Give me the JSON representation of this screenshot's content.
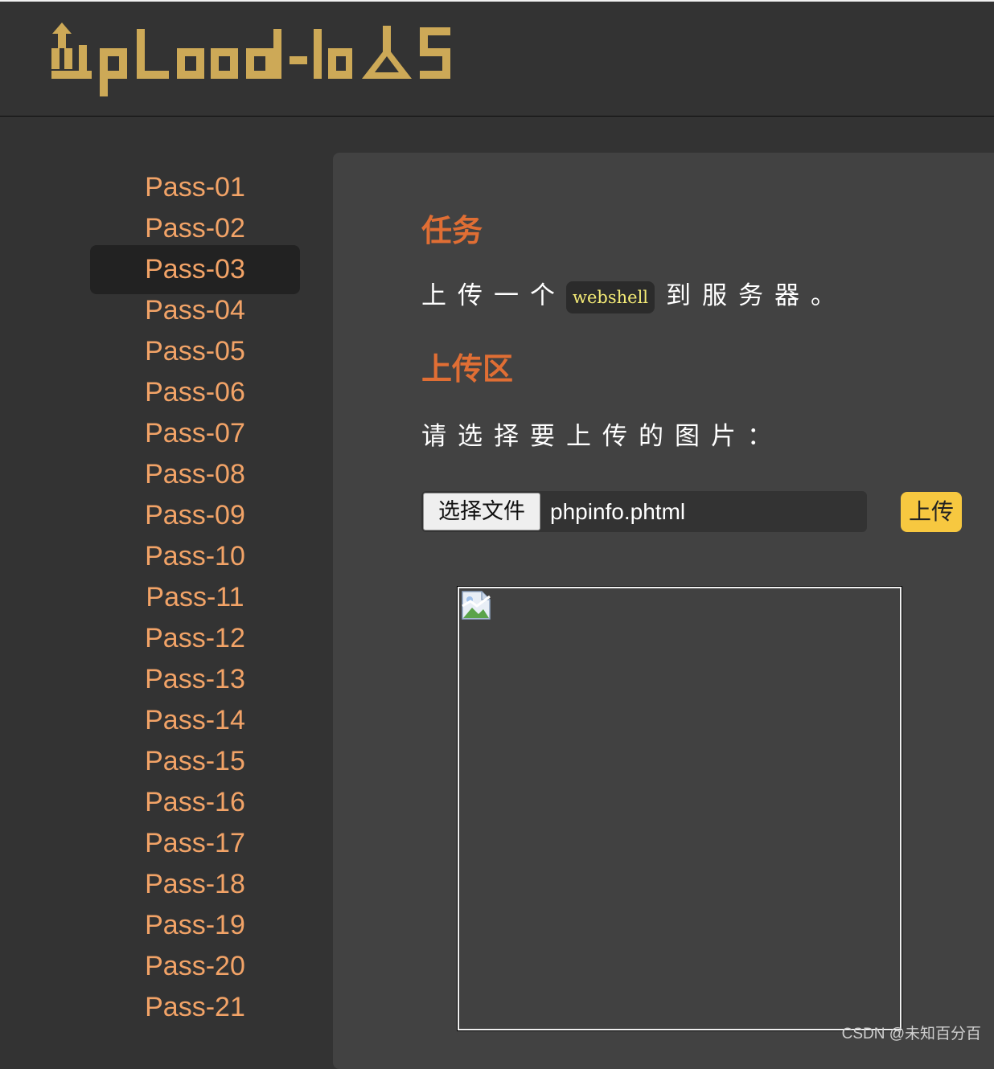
{
  "header": {
    "logo_text": "Upload-labs"
  },
  "sidebar": {
    "items": [
      {
        "label": "Pass-01"
      },
      {
        "label": "Pass-02"
      },
      {
        "label": "Pass-03",
        "active": true
      },
      {
        "label": "Pass-04"
      },
      {
        "label": "Pass-05"
      },
      {
        "label": "Pass-06"
      },
      {
        "label": "Pass-07"
      },
      {
        "label": "Pass-08"
      },
      {
        "label": "Pass-09"
      },
      {
        "label": "Pass-10"
      },
      {
        "label": "Pass-11"
      },
      {
        "label": "Pass-12"
      },
      {
        "label": "Pass-13"
      },
      {
        "label": "Pass-14"
      },
      {
        "label": "Pass-15"
      },
      {
        "label": "Pass-16"
      },
      {
        "label": "Pass-17"
      },
      {
        "label": "Pass-18"
      },
      {
        "label": "Pass-19"
      },
      {
        "label": "Pass-20"
      },
      {
        "label": "Pass-21"
      }
    ]
  },
  "main": {
    "task_heading": "任务",
    "task_prefix": "上传一个",
    "task_code": "webshell",
    "task_suffix": "到服务器。",
    "upload_heading": "上传区",
    "upload_prompt": "请选择要上传的图片：",
    "choose_file_label": "选择文件",
    "selected_file": "phpinfo.phtml",
    "upload_button_label": "上传"
  },
  "watermark": "CSDN @未知百分百",
  "colors": {
    "accent_orange": "#e06e34",
    "nav_text": "#f2a367",
    "logo_gold": "#cda957",
    "upload_button": "#f7c840",
    "code_text": "#f4eb76"
  },
  "icons": {
    "logo": "upload-labs-logo",
    "preview": "broken-image-icon"
  }
}
